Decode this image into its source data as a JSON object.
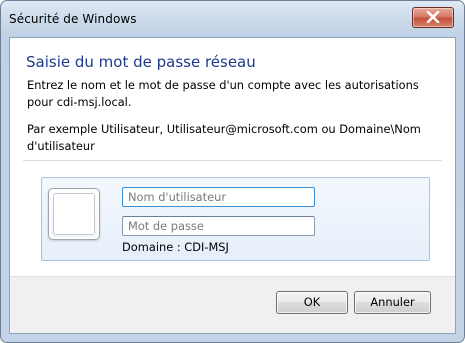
{
  "window": {
    "title": "Sécurité de Windows",
    "close_icon": "close-x"
  },
  "dialog": {
    "heading": "Saisie du mot de passe réseau",
    "description": "Entrez le nom et le mot de passe d'un compte avec les autorisations pour cdi-msj.local.",
    "example": "Par exemple Utilisateur, Utilisateur@microsoft.com ou Domaine\\Nom d'utilisateur"
  },
  "credentials": {
    "user_tile_icon": "user-tile",
    "username": {
      "value": "",
      "placeholder": "Nom d'utilisateur"
    },
    "password": {
      "value": "",
      "placeholder": "Mot de passe"
    },
    "domain": "Domaine : CDI-MSJ"
  },
  "buttons": {
    "ok": "OK",
    "cancel": "Annuler"
  },
  "colors": {
    "heading": "#1e3b8b",
    "close_button": "#c4513a",
    "focus_border": "#3a8fd6"
  }
}
